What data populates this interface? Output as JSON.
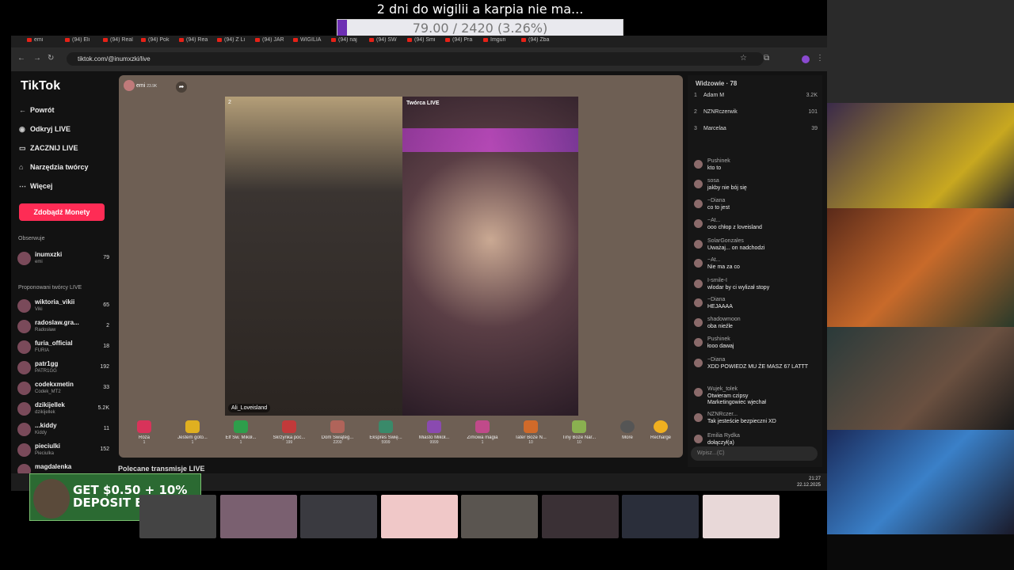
{
  "overlay": {
    "title": "2 dni do wigilii a karpia nie ma...",
    "goal_text": "79.00 / 2420 (3.26%)",
    "goal_fraction": 0.0326
  },
  "browser": {
    "tabs": [
      "emi",
      "(94) Eli",
      "(94) Real",
      "(94) Pok",
      "(94) Rea",
      "(94) Z Li",
      "(94) JAR",
      "WIGILIA",
      "(94) naj",
      "(94) SW",
      "(94) Smi",
      "(94) Pra",
      "Imgun",
      "(94) Zba"
    ],
    "url": "tiktok.com/@inumxzki/live"
  },
  "sidebar": {
    "logo": "TikTok",
    "nav": [
      {
        "icon": "back-icon",
        "label": "Powrót"
      },
      {
        "icon": "live-icon",
        "label": "Odkryj LIVE"
      },
      {
        "icon": "camera-icon",
        "label": "ZACZNIJ LIVE"
      },
      {
        "icon": "tools-icon",
        "label": "Narzędzia twórcy"
      },
      {
        "icon": "more-icon",
        "label": "Więcej"
      }
    ],
    "coins_button": "Zdobądź Monety",
    "following_header": "Obserwuje",
    "following": [
      {
        "name": "inumxzki",
        "sub": "emi",
        "count": "79"
      }
    ],
    "suggested_header": "Proponowani twórcy LIVE",
    "suggested": [
      {
        "name": "wiktoria_vikii",
        "sub": "Viki",
        "count": "65"
      },
      {
        "name": "radoslaw.gra...",
        "sub": "Radosław",
        "count": "2"
      },
      {
        "name": "furia_official",
        "sub": "FURIA",
        "count": "18"
      },
      {
        "name": "patr1gg",
        "sub": "PATR1GG",
        "count": "192"
      },
      {
        "name": "codekxmetin",
        "sub": "Codek_MT2",
        "count": "33"
      },
      {
        "name": "dzikijellek",
        "sub": "dzikijellek",
        "count": "5.2K"
      },
      {
        "name": "...kiddy",
        "sub": "Kiddy",
        "count": "11"
      },
      {
        "name": "pieciulki",
        "sub": "Pieciulka",
        "count": "152"
      },
      {
        "name": "magdalenka",
        "sub": "",
        "count": ""
      }
    ]
  },
  "live": {
    "host_name": "emi",
    "host_likes": "23.9K",
    "left_badge": "2",
    "left_label": "Ali_Loveisland",
    "right_label": "Twórca LIVE",
    "gifts": [
      {
        "name": "Róża",
        "price": "1",
        "color": "#d8335a"
      },
      {
        "name": "Jestem goto...",
        "price": "1",
        "color": "#e0b020"
      },
      {
        "name": "Elf Św. Mikoł...",
        "price": "1",
        "color": "#2e9e4b"
      },
      {
        "name": "Skrzynka poc...",
        "price": "199",
        "color": "#c23a3a"
      },
      {
        "name": "Dom Świąteg...",
        "price": "2200",
        "color": "#b0645a"
      },
      {
        "name": "Ekspres Świę...",
        "price": "5999",
        "color": "#3a8a6a"
      },
      {
        "name": "Miasto Mikoł...",
        "price": "9999",
        "color": "#8a4ab0"
      },
      {
        "name": "Zimowa magia",
        "price": "1",
        "color": "#c04a8a"
      },
      {
        "name": "Tater Boże N...",
        "price": "10",
        "color": "#d06a2a"
      },
      {
        "name": "Tiny Boże Nar...",
        "price": "10",
        "color": "#8ab050"
      }
    ],
    "more_label": "More",
    "recharge_label": "Recharge"
  },
  "chat": {
    "viewers_header": "Widzowie · 78",
    "viewers": [
      {
        "rank": "1",
        "name": "Adam M",
        "value": "3.2K"
      },
      {
        "rank": "2",
        "name": "NZNRczerwik",
        "value": "101"
      },
      {
        "rank": "3",
        "name": "Marcelaa",
        "value": "39"
      }
    ],
    "messages": [
      {
        "user": "Pushinek",
        "text": "kto to"
      },
      {
        "user": "sosa",
        "text": "jakby nie bój się"
      },
      {
        "user": "~Diana",
        "text": "co to jest"
      },
      {
        "user": "~At...",
        "text": "ooo chłop z loveisland"
      },
      {
        "user": "SolarGonzales",
        "text": "Uważaj... on nadchodzi"
      },
      {
        "user": "~At...",
        "text": "Nie ma za co"
      },
      {
        "user": "I-smile-I",
        "text": "wlodar by ci wylizał stopy"
      },
      {
        "user": "~Diana",
        "text": "HEJAAAA"
      },
      {
        "user": "shadowmoon",
        "text": "oba nieźle"
      },
      {
        "user": "Pushinek",
        "text": "łooo dawaj"
      },
      {
        "user": "~Diana",
        "text": "XDD POWIEDZ MU ŻE MASZ 67 LATTT"
      },
      {
        "user": "Wujek_tolek",
        "text": "Otwieram czipsy"
      },
      {
        "user": "",
        "text": "Marketingowiec wjechał"
      },
      {
        "user": "NZNRczer...",
        "text": "Tak jesteście bezpieczni XD"
      },
      {
        "user": "Emilia Rydka",
        "text": "dołączył(a)"
      }
    ],
    "input_placeholder": "Wpisz...(C)"
  },
  "recommended": "Polecane transmisje LIVE",
  "taskbar": {
    "time": "21:27",
    "date": "22.12.2025"
  },
  "promo": {
    "line1": "GET $0.50 + 10%",
    "line2": "DEPOSIT BONUS"
  }
}
